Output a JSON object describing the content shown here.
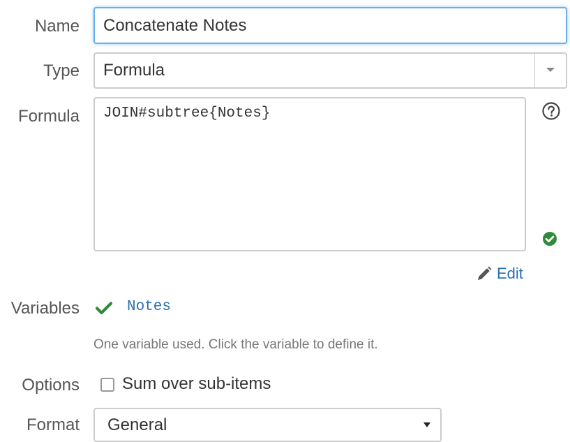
{
  "form": {
    "name": {
      "label": "Name",
      "value": "Concatenate Notes"
    },
    "type": {
      "label": "Type",
      "value": "Formula"
    },
    "formula": {
      "label": "Formula",
      "value": "JOIN#subtree{Notes}",
      "edit_label": "Edit"
    },
    "variables": {
      "label": "Variables",
      "items": [
        {
          "name": "Notes",
          "status": "defined"
        }
      ],
      "hint": "One variable used. Click the variable to define it."
    },
    "options": {
      "label": "Options",
      "sum_over_subitems": {
        "label": "Sum over sub-items",
        "checked": false
      }
    },
    "format": {
      "label": "Format",
      "value": "General"
    }
  },
  "icons": {
    "help": "question-circle-icon",
    "valid": "check-circle-icon",
    "edit": "pencil-icon",
    "variable_ok": "check-icon"
  },
  "colors": {
    "focus_border": "#66afe9",
    "link": "#2a6fb0",
    "success": "#2e8b3a"
  }
}
